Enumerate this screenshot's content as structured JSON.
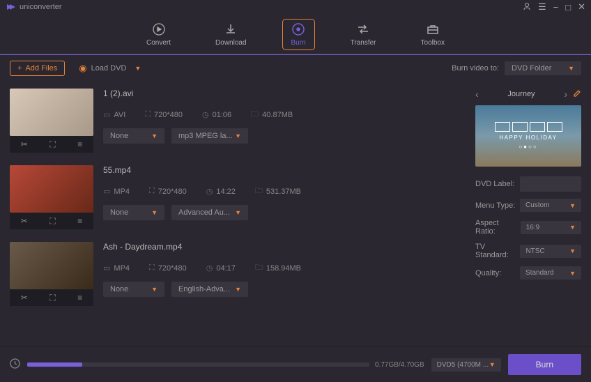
{
  "app_name": "uniconverter",
  "tabs": [
    {
      "label": "Convert"
    },
    {
      "label": "Download"
    },
    {
      "label": "Burn"
    },
    {
      "label": "Transfer"
    },
    {
      "label": "Toolbox"
    }
  ],
  "toolbar": {
    "add_files": "Add Files",
    "load_dvd": "Load DVD",
    "burn_to_label": "Burn video to:",
    "burn_to_value": "DVD Folder"
  },
  "files": [
    {
      "name": "1 (2).avi",
      "format": "AVI",
      "resolution": "720*480",
      "duration": "01:06",
      "size": "40.87MB",
      "subtitle": "None",
      "audio": "mp3 MPEG la..."
    },
    {
      "name": "55.mp4",
      "format": "MP4",
      "resolution": "720*480",
      "duration": "14:22",
      "size": "531.37MB",
      "subtitle": "None",
      "audio": "Advanced Au..."
    },
    {
      "name": "Ash - Daydream.mp4",
      "format": "MP4",
      "resolution": "720*480",
      "duration": "04:17",
      "size": "158.94MB",
      "subtitle": "None",
      "audio": "English-Adva..."
    }
  ],
  "sidebar": {
    "menu_name": "Journey",
    "preview_text": "HAPPY HOLIDAY",
    "dvd_label_label": "DVD Label:",
    "dvd_label_value": "",
    "menu_type_label": "Menu Type:",
    "menu_type_value": "Custom",
    "aspect_ratio_label": "Aspect Ratio:",
    "aspect_ratio_value": "16:9",
    "tv_standard_label": "TV Standard:",
    "tv_standard_value": "NTSC",
    "quality_label": "Quality:",
    "quality_value": "Standard"
  },
  "footer": {
    "progress_text": "0.77GB/4.70GB",
    "dvd_type": "DVD5 (4700M ...",
    "burn_button": "Burn"
  }
}
